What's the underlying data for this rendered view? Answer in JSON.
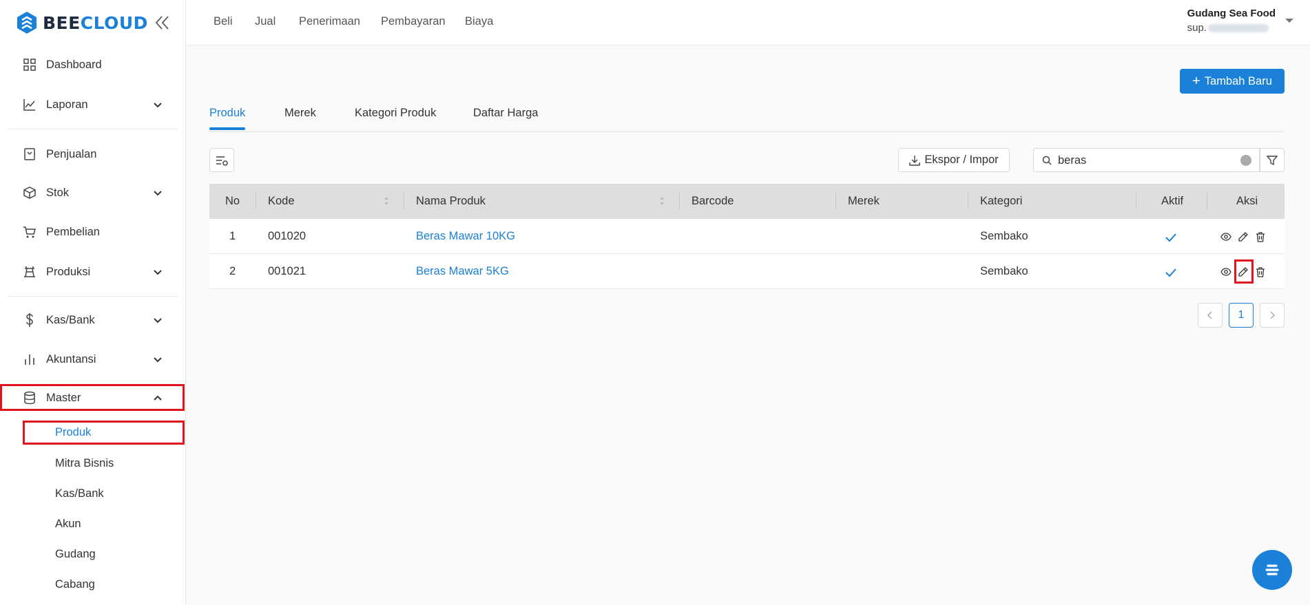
{
  "brand": {
    "part1": "BEE",
    "part2": "CLOUD"
  },
  "sidebar": {
    "items": [
      {
        "label": "Dashboard",
        "icon": "grid-icon"
      },
      {
        "label": "Laporan",
        "icon": "chart-line-icon"
      },
      {
        "label": "Penjualan",
        "icon": "receipt-icon"
      },
      {
        "label": "Stok",
        "icon": "box-icon"
      },
      {
        "label": "Pembelian",
        "icon": "cart-icon"
      },
      {
        "label": "Produksi",
        "icon": "factory-icon"
      },
      {
        "label": "Kas/Bank",
        "icon": "dollar-icon"
      },
      {
        "label": "Akuntansi",
        "icon": "bar-chart-icon"
      },
      {
        "label": "Master",
        "icon": "database-icon"
      }
    ],
    "master_sub": [
      "Produk",
      "Mitra Bisnis",
      "Kas/Bank",
      "Akun",
      "Gudang",
      "Cabang"
    ]
  },
  "topbar": {
    "links": [
      "Beli",
      "Jual",
      "Penerimaan",
      "Pembayaran",
      "Biaya"
    ],
    "account_name": "Gudang Sea Food",
    "account_email_prefix": "sup."
  },
  "main": {
    "add_button": "Tambah Baru",
    "tabs": [
      "Produk",
      "Merek",
      "Kategori Produk",
      "Daftar Harga"
    ],
    "active_tab": "Produk",
    "export_button": "Ekspor / Impor",
    "search_value": "beras",
    "table": {
      "headers": [
        "No",
        "Kode",
        "Nama Produk",
        "Barcode",
        "Merek",
        "Kategori",
        "Aktif",
        "Aksi"
      ],
      "rows": [
        {
          "no": "1",
          "kode": "001020",
          "nama": "Beras Mawar 10KG",
          "barcode": "",
          "merek": "",
          "kategori": "Sembako",
          "aktif": true
        },
        {
          "no": "2",
          "kode": "001021",
          "nama": "Beras Mawar 5KG",
          "barcode": "",
          "merek": "",
          "kategori": "Sembako",
          "aktif": true
        }
      ]
    },
    "pagination": {
      "current_page": "1"
    }
  },
  "colors": {
    "accent": "#1a80d8",
    "highlight": "#e0141d",
    "header_bg": "#dedede"
  }
}
